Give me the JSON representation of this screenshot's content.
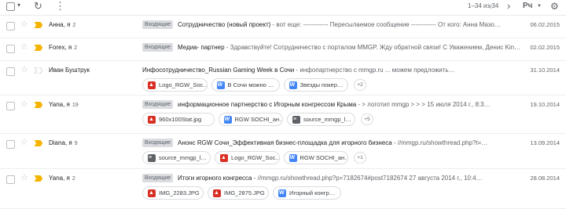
{
  "toolbar": {
    "range": "1–34 из 34",
    "lang": "Рч",
    "icons": [
      "checkbox",
      "dropdown-caret",
      "refresh-icon",
      "more-vert-icon",
      "chevron-left-icon",
      "chevron-right-icon",
      "input-tools-icon",
      "gear-icon"
    ]
  },
  "colors": {
    "important": "#f4b400",
    "label_bg": "#dadce0",
    "pdf_red": "#d93025",
    "doc_blue": "#4285f4"
  },
  "rows": [
    {
      "sender": "Анна, я",
      "count": "2",
      "label": "Входящие",
      "subject": "Сотрудничество (новый проект)",
      "snippet": " - вот еще: ------------ Пересылаемое сообщение ------------ От кого: Анна Мазо…",
      "date": "06.02.2015",
      "important": true
    },
    {
      "sender": "Forex, я",
      "count": "2",
      "label": "Входящие",
      "subject": "Медиа- партнер",
      "snippet": " - Здравствуйте! Сотрудничество с порталом MMGP. Жду обратной связи! С Уважением, Денис Kind regards, Forex Affilia…",
      "date": "02.02.2015",
      "important": true
    },
    {
      "sender": "Иван Буштрук",
      "count": "",
      "label": "",
      "subject": "Инфосотрудничество_Russian Gaming Week в Сочи",
      "snippet": " - инфопартнерство с mmgp.ru ... можем предложить…",
      "date": "31.10.2014",
      "important": false,
      "attachments": [
        {
          "name": "Logo_RGW_Soc…",
          "type": "img"
        },
        {
          "name": "В Сочи можно …",
          "type": "doc"
        },
        {
          "name": "Звезды покер…",
          "type": "doc"
        }
      ],
      "more": "+2"
    },
    {
      "sender": "Yana, я",
      "count": "19",
      "label": "Входящие",
      "subject": "информационное партнерство с Игорным конгрессом Крыма",
      "snippet": " - > логотип mmgp > > > 15 июля 2014 г., 8:3…",
      "date": "19.10.2014",
      "important": true,
      "attachments": [
        {
          "name": "960x100Stat.jpg",
          "type": "img"
        },
        {
          "name": "RGW SOCHI_ан…",
          "type": "doc"
        },
        {
          "name": "source_mmgp_l…",
          "type": "file"
        }
      ],
      "more": "+5"
    },
    {
      "sender": "Diana, я",
      "count": "9",
      "label": "Входящие",
      "subject": "Анонс RGW Сочи_Эффективная бизнес-площадка для игорного бизнеса",
      "snippet": " - //mmgp.ru/showthread.php?t=…",
      "date": "13.09.2014",
      "important": true,
      "attachments": [
        {
          "name": "source_mmgp_l…",
          "type": "file"
        },
        {
          "name": "Logo_RGW_Soc…",
          "type": "img"
        },
        {
          "name": "RGW SOCHI_ан…",
          "type": "doc"
        }
      ],
      "more": "+1"
    },
    {
      "sender": "Yana, я",
      "count": "2",
      "label": "Входящие",
      "subject": "Итоги игорного конгресса",
      "snippet": " - //mmgp.ru/showthread.php?p=7182674#post7182674 27 августа 2014 г., 10:4…",
      "date": "28.08.2014",
      "important": true,
      "attachments": [
        {
          "name": "IMG_2283.JPG",
          "type": "img"
        },
        {
          "name": "IMG_2875.JPG",
          "type": "img"
        },
        {
          "name": "Игорный конгр…",
          "type": "doc"
        }
      ],
      "more": ""
    }
  ]
}
